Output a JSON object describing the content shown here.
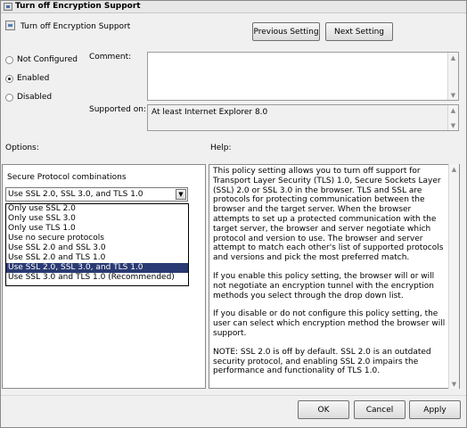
{
  "window": {
    "title": "Turn off Encryption Support"
  },
  "header": {
    "title": "Turn off Encryption Support"
  },
  "nav": {
    "previous_label": "Previous Setting",
    "next_label": "Next Setting"
  },
  "state": {
    "options": [
      {
        "label": "Not Configured",
        "checked": false
      },
      {
        "label": "Enabled",
        "checked": true
      },
      {
        "label": "Disabled",
        "checked": false
      }
    ]
  },
  "comment": {
    "label": "Comment:",
    "value": ""
  },
  "supported": {
    "label": "Supported on:",
    "value": "At least Internet Explorer 8.0"
  },
  "options_label": "Options:",
  "help_label": "Help:",
  "protocol": {
    "label": "Secure Protocol combinations",
    "selected": "Use SSL 2.0, SSL 3.0, and TLS 1.0",
    "items": [
      "Only use SSL 2.0",
      "Only use SSL 3.0",
      "Only use TLS 1.0",
      "Use no secure protocols",
      "Use SSL 2.0 and SSL 3.0",
      "Use SSL 2.0 and TLS 1.0",
      "Use SSL 2.0, SSL 3.0, and TLS 1.0",
      "Use SSL 3.0 and TLS 1.0 (Recommended)"
    ]
  },
  "help": {
    "paragraphs": [
      "This policy setting allows you to turn off support for Transport Layer Security (TLS) 1.0, Secure Sockets Layer (SSL) 2.0 or SSL 3.0 in the browser.  TLS and SSL are protocols for protecting communication between the browser and the target server. When the browser attempts to set up a protected communication with the target server, the browser and server negotiate which protocol and version to use. The browser and server attempt to match each other's list of supported protocols and versions and pick the most preferred match.",
      "If you enable this policy setting, the browser will or will not negotiate an encryption tunnel with the encryption methods you select through the drop down list.",
      "If you disable or do not configure this policy setting, the user can select which encryption method the browser will support.",
      "NOTE: SSL 2.0 is off by default. SSL 2.0 is an outdated security protocol, and enabling SSL 2.0 impairs the performance and functionality of TLS 1.0."
    ]
  },
  "footer": {
    "ok_label": "OK",
    "cancel_label": "Cancel",
    "apply_label": "Apply"
  }
}
